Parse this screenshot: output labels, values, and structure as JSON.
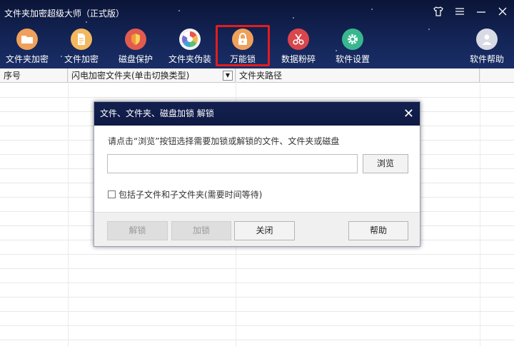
{
  "app": {
    "title": "文件夹加密超级大师（正式版）"
  },
  "window_controls": {
    "skin_icon": "shirt-icon",
    "menu_icon": "menu-icon",
    "min_icon": "minimize-icon",
    "close_icon": "close-icon"
  },
  "toolbar": {
    "items": [
      {
        "label": "文件夹加密",
        "icon": "folder-lock-icon",
        "color": "#f0a05a"
      },
      {
        "label": "文件加密",
        "icon": "file-lock-icon",
        "color": "#f3b75e"
      },
      {
        "label": "磁盘保护",
        "icon": "shield-icon",
        "color": "#e25b4f"
      },
      {
        "label": "文件夹伪装",
        "icon": "disguise-icon",
        "color": "#f2f2f2"
      },
      {
        "label": "万能锁",
        "icon": "padlock-icon",
        "color": "#f0a05a"
      },
      {
        "label": "数据粉碎",
        "icon": "scissors-icon",
        "color": "#d9464b"
      },
      {
        "label": "软件设置",
        "icon": "gear-icon",
        "color": "#38b78f"
      },
      {
        "label": "软件帮助",
        "icon": "user-icon",
        "color": "#d8dbe4"
      }
    ],
    "active_index": 4
  },
  "grid": {
    "columns": [
      "序号",
      "闪电加密文件夹(单击切换类型)",
      "文件夹路径"
    ],
    "dropdown_glyph": "▼"
  },
  "dialog": {
    "title": "文件、文件夹、磁盘加锁 解锁",
    "close_glyph": "✕",
    "hint": "请点击“浏览”按钮选择需要加锁或解锁的文件、文件夹或磁盘",
    "path_value": "",
    "browse_label": "浏览",
    "checkbox_label": "包括子文件和子文件夹(需要时间等待)",
    "checkbox_checked": false,
    "unlock_label": "解锁",
    "lock_label": "加锁",
    "close_label": "关闭",
    "help_label": "帮助"
  }
}
